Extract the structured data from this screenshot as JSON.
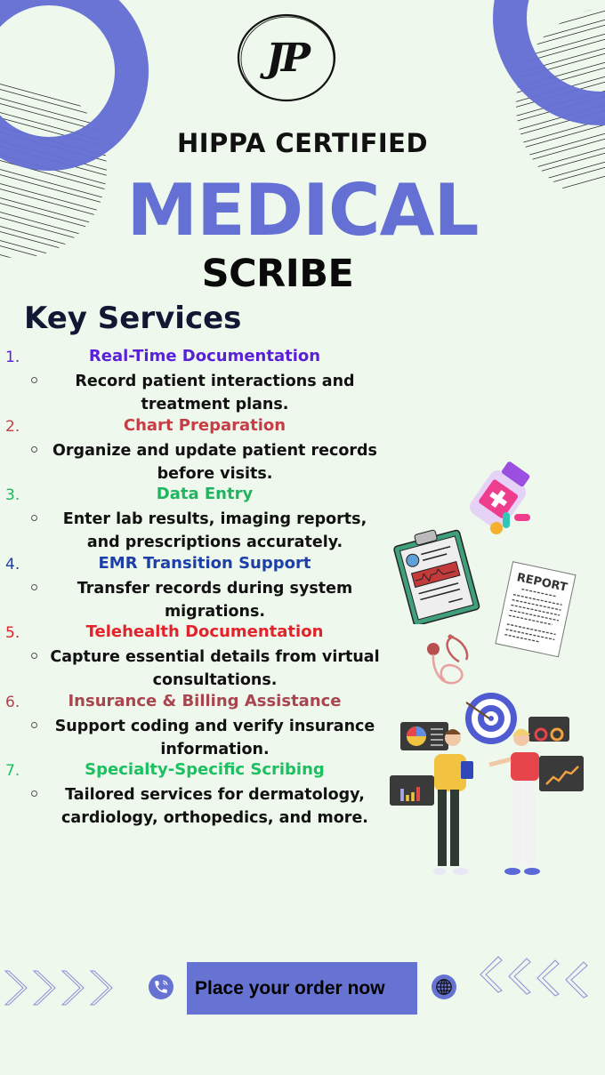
{
  "logo": {
    "initials": "JP"
  },
  "header": {
    "subtitle": "HIPPA CERTIFIED",
    "title": "MEDICAL",
    "title2": "SCRIBE"
  },
  "section_title": "Key Services",
  "colors": {
    "accent": "#6470d4",
    "background": "#eef8ec"
  },
  "services": [
    {
      "num": "1.",
      "title": "Real-Time Documentation",
      "color": "#5a1fd8",
      "desc": "Record patient interactions and treatment plans."
    },
    {
      "num": "2.",
      "title": "Chart Preparation",
      "color": "#c63d45",
      "desc": "Organize and update patient records before visits."
    },
    {
      "num": "3.",
      "title": "Data Entry",
      "color": "#1fb460",
      "desc": "Enter lab results, imaging reports, and prescriptions accurately."
    },
    {
      "num": "4.",
      "title": "EMR Transition Support",
      "color": "#1d3fa8",
      "desc": "Transfer records during system migrations."
    },
    {
      "num": "5.",
      "title": "Telehealth Documentation",
      "color": "#e3232b",
      "desc": "Capture essential details from virtual consultations."
    },
    {
      "num": "6.",
      "title": "Insurance & Billing Assistance",
      "color": "#a8454f",
      "desc": "Support coding and verify insurance information."
    },
    {
      "num": "7.",
      "title": "Specialty-Specific Scribing",
      "color": "#1cc060",
      "desc": "Tailored services for dermatology, cardiology, orthopedics, and more."
    }
  ],
  "illustrations": {
    "report_label": "REPORT"
  },
  "footer": {
    "cta_label": "Place your order now",
    "left_icon": "phone-icon",
    "right_icon": "globe-icon"
  }
}
